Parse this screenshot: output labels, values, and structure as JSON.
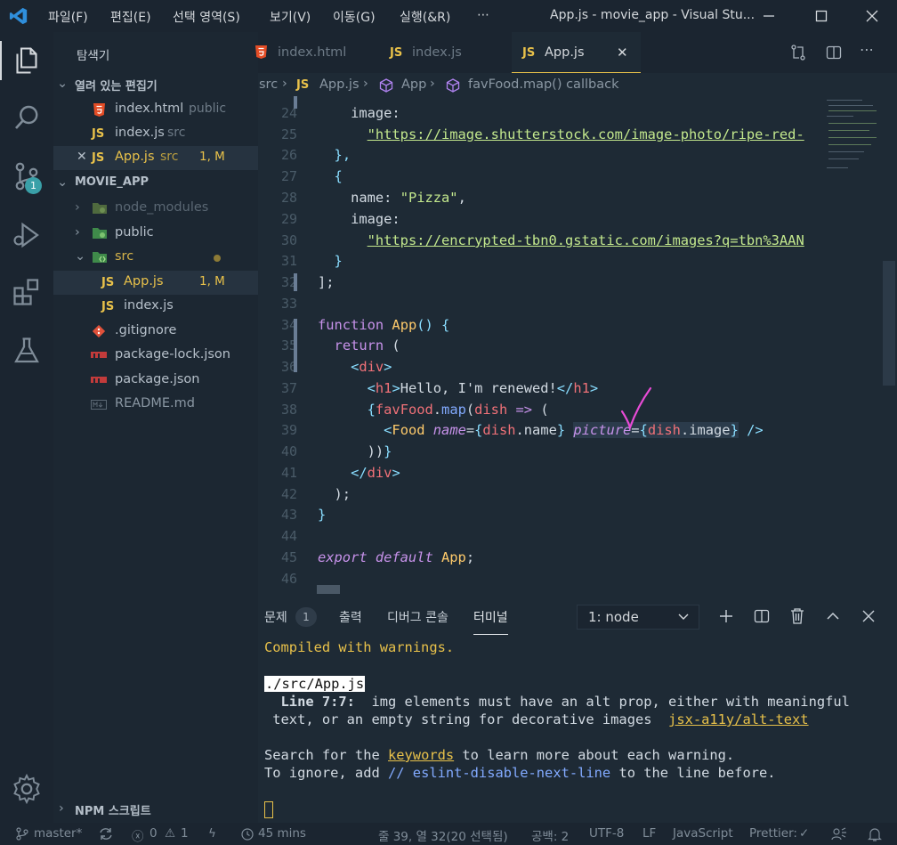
{
  "titlebar": {
    "menus": [
      "파일(F)",
      "편집(E)",
      "선택 영역(S)",
      "보기(V)",
      "이동(G)",
      "실행(&R)",
      "⋯"
    ],
    "title": "App.js - movie_app - Visual Stu..."
  },
  "activity": {
    "scm_badge": "1"
  },
  "sidebar": {
    "title": "탐색기",
    "open_editors": "열려 있는 편집기",
    "open_files": [
      {
        "name": "index.html",
        "desc": "public",
        "kind": "html"
      },
      {
        "name": "index.js",
        "desc": "src",
        "kind": "js"
      },
      {
        "name": "App.js",
        "desc": "src",
        "kind": "js",
        "status": "1, M"
      }
    ],
    "project": "MOVIE_APP",
    "tree": [
      {
        "name": "node_modules",
        "kind": "folder"
      },
      {
        "name": "public",
        "kind": "folder"
      },
      {
        "name": "src",
        "kind": "folder"
      },
      {
        "name": "App.js",
        "kind": "js",
        "status": "1, M"
      },
      {
        "name": "index.js",
        "kind": "js"
      },
      {
        "name": ".gitignore",
        "kind": "git"
      },
      {
        "name": "package-lock.json",
        "kind": "npm"
      },
      {
        "name": "package.json",
        "kind": "npm"
      },
      {
        "name": "README.md",
        "kind": "md"
      }
    ],
    "npm_scripts": "NPM 스크립트",
    "js_badge": "JS"
  },
  "tabs": [
    {
      "label": "index.html",
      "kind": "html"
    },
    {
      "label": "index.js",
      "kind": "js"
    },
    {
      "label": "App.js",
      "kind": "js",
      "active": true
    }
  ],
  "breadcrumb": [
    "src",
    "App.js",
    "App",
    "favFood.map() callback"
  ],
  "code_lines": [
    "24",
    "25",
    "26",
    "27",
    "28",
    "29",
    "30",
    "31",
    "32",
    "33",
    "34",
    "35",
    "36",
    "37",
    "38",
    "39",
    "40",
    "41",
    "42",
    "43",
    "44",
    "45",
    "46"
  ],
  "code": {
    "l24": "image:",
    "l25": "\"https://image.shutterstock.com/image-photo/ripe-red-",
    "l26": "},",
    "l27": "{",
    "l28_key": "name",
    "l28_val": "\"Pizza\"",
    "l29": "image:",
    "l30": "\"https://encrypted-tbn0.gstatic.com/images?q=tbn%3AAN",
    "l31": "}",
    "l32": "];",
    "l34_kw": "function",
    "l34_fn": "App",
    "l35_kw": "return",
    "l36_tag": "div",
    "l37_tag": "h1",
    "l37_text": "Hello, I'm renewed!",
    "l38_obj": "favFood",
    "l38_m": "map",
    "l38_arg": "dish",
    "l39_comp": "Food",
    "l39_attr1": "name",
    "l39_attr2": "picture",
    "l39_obj": "dish",
    "l39_p1": "name",
    "l39_p2": "image",
    "l45_kw": "export default",
    "l45_id": "App"
  },
  "panel": {
    "tabs": [
      "문제",
      "출력",
      "디버그 콘솔",
      "터미널"
    ],
    "problems_count": "1",
    "terminal_select": "1: node"
  },
  "terminal": {
    "l1": "Compiled with warnings.",
    "l2": "./src/App.js",
    "l3a": "  Line 7:7:",
    "l3b": "  img elements must have an alt prop, either with meaningful",
    "l4a": " text, or an empty string for decorative images",
    "l4b": "jsx-a11y/alt-text",
    "l5a": "Search for the ",
    "l5b": "keywords",
    "l5c": " to learn more about each warning.",
    "l6a": "To ignore, add ",
    "l6b": "// eslint-disable-next-line",
    "l6c": " to the line before."
  },
  "status": {
    "branch": "master*",
    "errors": "0",
    "warnings": "1",
    "time": "45 mins",
    "position": "줄 39, 열 32(20 선택됨)",
    "spaces": "공백: 2",
    "encoding": "UTF-8",
    "eol": "LF",
    "language": "JavaScript",
    "formatter": "Prettier:"
  },
  "colors": {
    "accent": "#e8c14a",
    "bg": "#1e2a35",
    "sidebar": "#1c2732",
    "titlebar": "#1b2530"
  }
}
